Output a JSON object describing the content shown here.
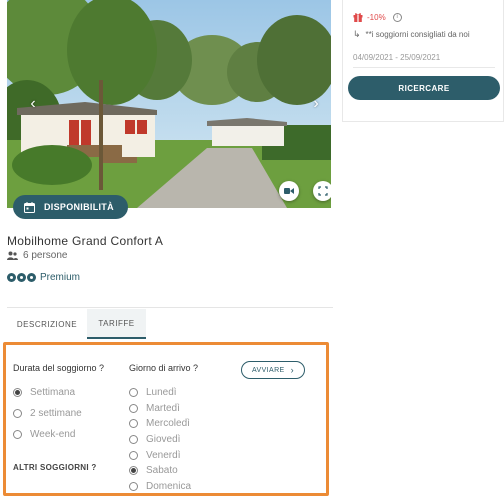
{
  "gallery": {
    "prev_arrow": "‹",
    "next_arrow": "›"
  },
  "availability_button": {
    "label": "DISPONIBILITÀ"
  },
  "listing": {
    "title": "Mobilhome Grand Confort A",
    "persons": "6 persone",
    "rating_label": "Premium",
    "rating_level": 3
  },
  "tabs": [
    {
      "label": "DESCRIZIONE",
      "active": false
    },
    {
      "label": "TARIFFE",
      "active": true
    }
  ],
  "booking": {
    "duration_label": "Durata del soggiorno ?",
    "arrival_label": "Giorno di arrivo ?",
    "start_button": "AVVIARE",
    "start_chevron": "›",
    "durations": [
      {
        "label": "Settimana",
        "selected": true
      },
      {
        "label": "2 settimane",
        "selected": false
      },
      {
        "label": "Week-end",
        "selected": false
      }
    ],
    "days": [
      {
        "label": "Lunedì",
        "selected": false
      },
      {
        "label": "Martedì",
        "selected": false
      },
      {
        "label": "Mercoledì",
        "selected": false
      },
      {
        "label": "Giovedì",
        "selected": false
      },
      {
        "label": "Venerdì",
        "selected": false
      },
      {
        "label": "Sabato",
        "selected": true
      },
      {
        "label": "Domenica",
        "selected": false
      }
    ],
    "other_stays": "ALTRI SOGGIORNI ?"
  },
  "sidebar": {
    "discount": "-10%",
    "info_glyph": "i",
    "suggestion_arrow": "↳",
    "suggestion": "**i soggiorni consigliati da noi",
    "dates": "04/09/2021 - 25/09/2021",
    "search_button": "RICERCARE"
  },
  "colors": {
    "primary": "#2d5d6a",
    "highlight_border": "#ec8b35",
    "discount": "#e04a4a"
  }
}
